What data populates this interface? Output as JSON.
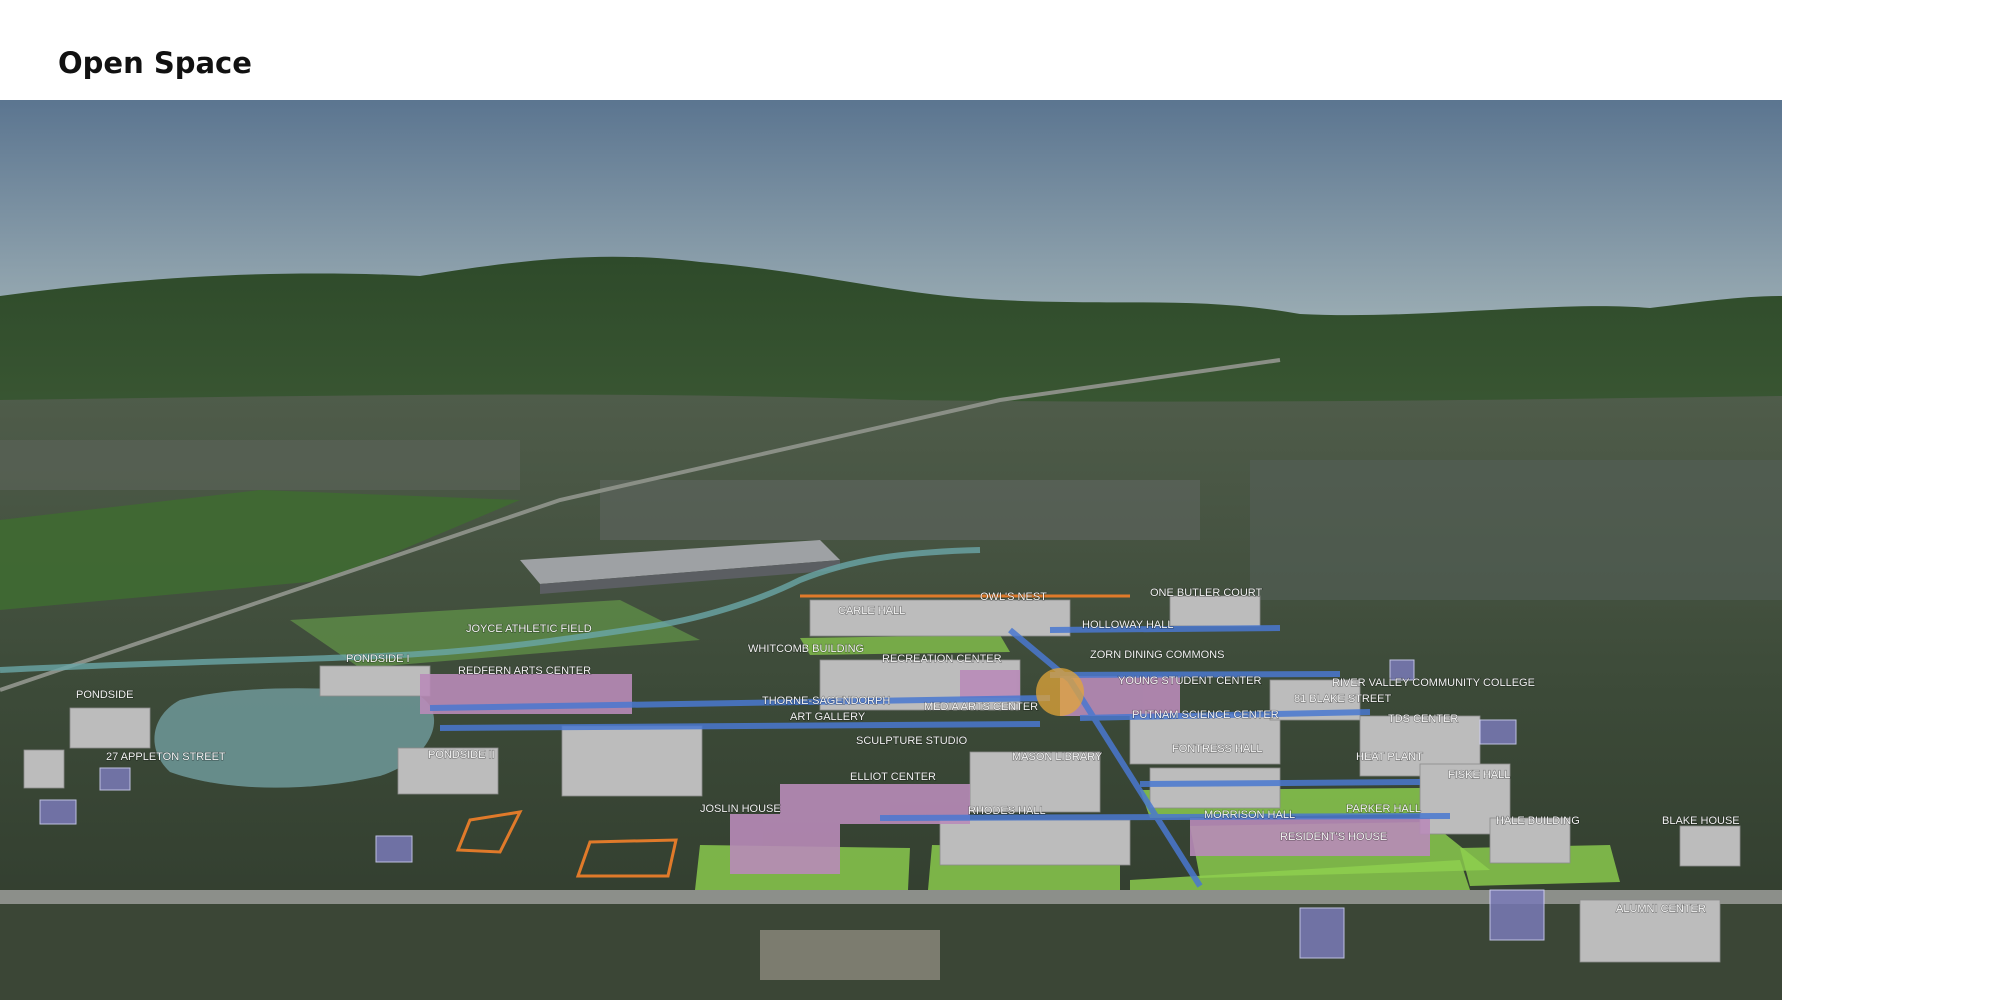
{
  "page": {
    "title": "Open Space"
  },
  "map": {
    "buildings": {
      "owls_nest": "OWL'S NEST",
      "one_butler_court": "ONE BUTLER COURT",
      "carle_hall": "CARLE HALL",
      "holloway_hall": "HOLLOWAY HALL",
      "joyce_athletic_field": "JOYCE ATHLETIC FIELD",
      "whitcomb_building": "WHITCOMB BUILDING",
      "recreation_center": "RECREATION CENTER",
      "zorn_dining_commons": "ZORN DINING COMMONS",
      "pondside_i": "PONDSIDE I",
      "redfern_arts_center": "REDFERN ARTS CENTER",
      "young_student_center": "YOUNG STUDENT CENTER",
      "river_valley_community_college": "RIVER VALLEY COMMUNITY COLLEGE",
      "pondside_left": "PONDSIDE",
      "thorne_sagendorph": "THORNE-SAGENDORPH",
      "art_gallery": "ART GALLERY",
      "media_arts_center": "MEDIA ARTS CENTER",
      "blake_street_81": "81 BLAKE STREET",
      "putnam_science_center": "PUTNAM SCIENCE CENTER",
      "tds_center": "TDS CENTER",
      "appleton_street_27": "27 APPLETON STREET",
      "pondside_ii": "PONDSIDE II",
      "sculpture_studio": "SCULPTURE STUDIO",
      "mason_library": "MASON LIBRARY",
      "fontress_hall": "FONTRESS HALL",
      "heat_plant": "HEAT PLANT",
      "elliot_center": "ELLIOT CENTER",
      "fiske_hall": "FISKE HALL",
      "joslin_house": "JOSLIN HOUSE",
      "rhodes_hall": "RHODES HALL",
      "morrison_hall": "MORRISON HALL",
      "parker_hall": "PARKER HALL",
      "hale_building": "HALE BUILDING",
      "blake_house": "BLAKE HOUSE",
      "residents_house": "RESIDENT'S HOUSE",
      "alumni_center": "ALUMNI CENTER"
    },
    "colors": {
      "sky_top": "#5f7890",
      "sky_bottom": "#94a7b0",
      "mountain": "#2f4d2b",
      "ground": "#3a4a36",
      "open_space": "#8fd14f",
      "walkway": "#4a78d0",
      "arts_buildings": "#b88bb8",
      "building": "#bdbdbd",
      "orange_outline": "#e07a2a",
      "pond": "#6b9494"
    }
  }
}
